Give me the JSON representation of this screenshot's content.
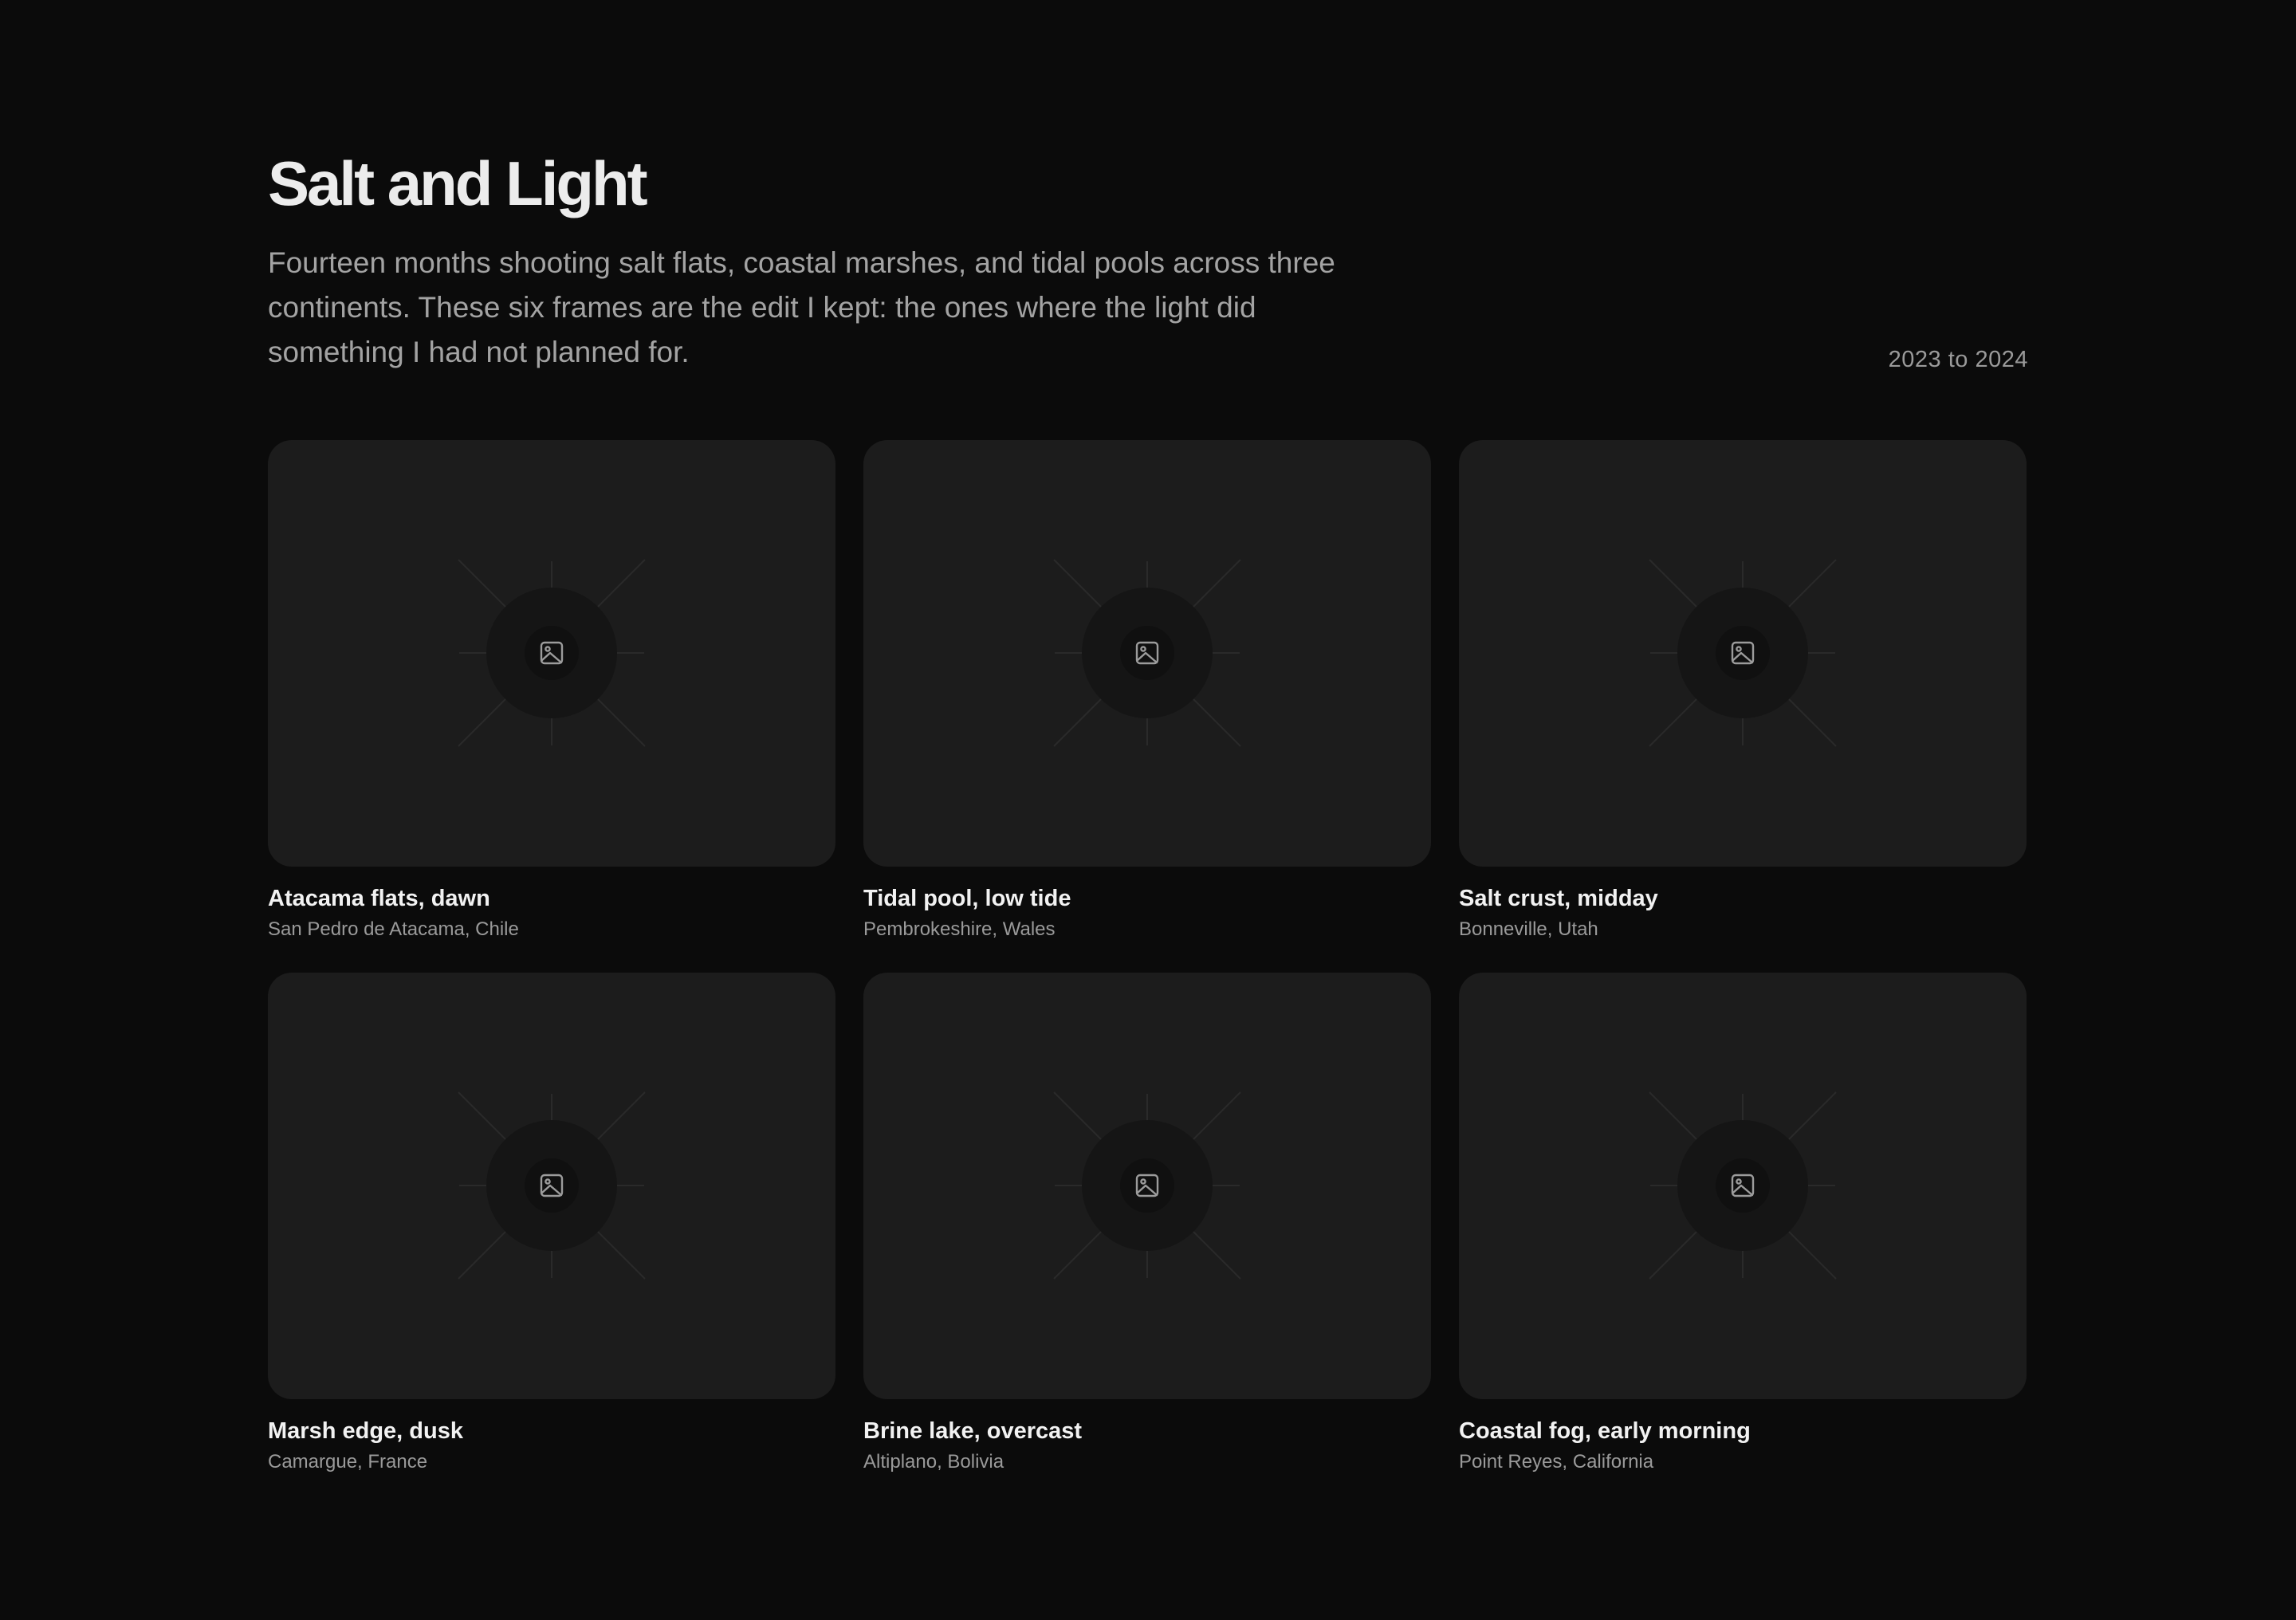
{
  "header": {
    "title": "Salt and Light",
    "intro": "Fourteen months shooting salt flats, coastal marshes, and tidal pools across three continents. These six frames are the edit I kept: the ones where the light did something I had not planned for.",
    "years": "2023 to 2024"
  },
  "gallery": {
    "placeholder_icon": "image-icon",
    "items": [
      {
        "title": "Atacama flats, dawn",
        "place": "San Pedro de Atacama, Chile"
      },
      {
        "title": "Tidal pool, low tide",
        "place": "Pembrokeshire, Wales"
      },
      {
        "title": "Salt crust, midday",
        "place": "Bonneville, Utah"
      },
      {
        "title": "Marsh edge, dusk",
        "place": "Camargue, France"
      },
      {
        "title": "Brine lake, overcast",
        "place": "Altiplano, Bolivia"
      },
      {
        "title": "Coastal fog, early morning",
        "place": "Point Reyes, California"
      }
    ]
  },
  "colors": {
    "background": "#0b0b0b",
    "card": "#1c1c1c",
    "title_text": "#ececec",
    "muted_text": "#9a9a9a"
  }
}
